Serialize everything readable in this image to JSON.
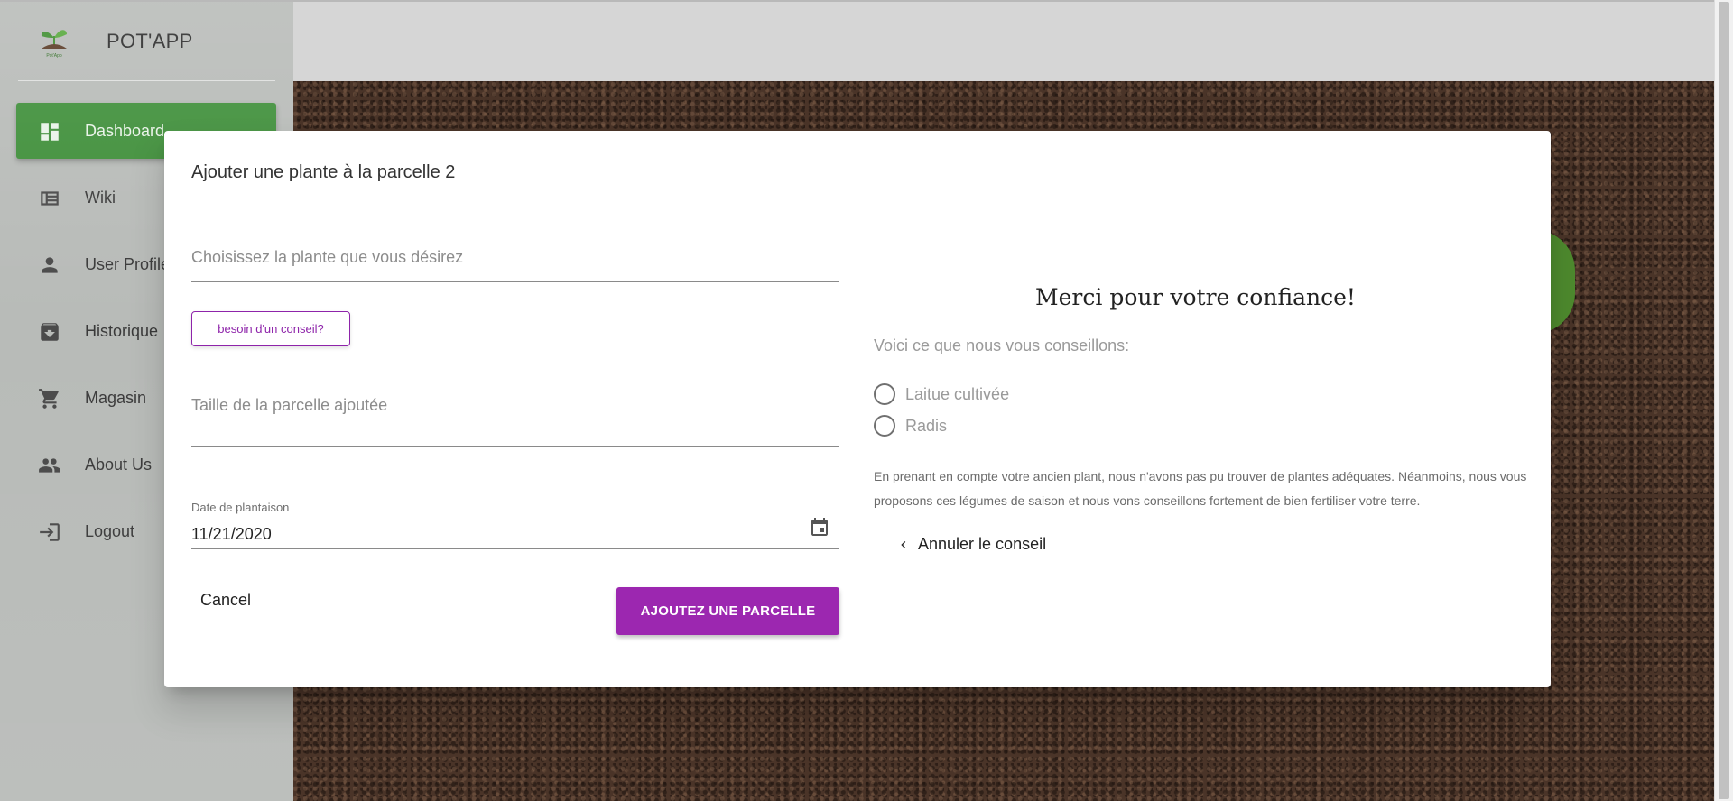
{
  "app": {
    "title": "POT'APP",
    "logo_text": "Pot'App"
  },
  "sidebar": {
    "items": [
      {
        "label": "Dashboard",
        "icon": "dashboard-icon",
        "active": true
      },
      {
        "label": "Wiki",
        "icon": "wiki-icon",
        "active": false
      },
      {
        "label": "User Profile",
        "icon": "person-icon",
        "active": false
      },
      {
        "label": "Historique",
        "icon": "archive-icon",
        "active": false
      },
      {
        "label": "Magasin",
        "icon": "cart-icon",
        "active": false
      },
      {
        "label": "About Us",
        "icon": "group-icon",
        "active": false
      },
      {
        "label": "Logout",
        "icon": "logout-icon",
        "active": false
      }
    ]
  },
  "dialog": {
    "title": "Ajouter une plante à la parcelle 2",
    "plant_field": {
      "placeholder": "Choisissez la plante que vous désirez",
      "value": ""
    },
    "advice_button": "besoin d'un conseil?",
    "size_field": {
      "placeholder": "Taille de la parcelle ajoutée",
      "value": ""
    },
    "date_field": {
      "label": "Date de plantaison",
      "value": "11/21/2020"
    },
    "cancel_label": "Cancel",
    "submit_label": "AJOUTEZ UNE PARCELLE",
    "advice": {
      "heading": "Merci pour votre confiance!",
      "intro": "Voici ce que nous vous conseillons:",
      "options": [
        "Laitue cultivée",
        "Radis"
      ],
      "note": "En prenant en compte votre ancien plant, nous n'avons pas pu trouver de plantes adéquates. Néanmoins, nous vous proposons ces légumes de saison et nous vons conseillons fortement de bien fertiliser votre terre.",
      "cancel_advice_label": "Annuler le conseil"
    }
  },
  "colors": {
    "accent": "#9c27b0",
    "sidebar_active": "#3f8f3a",
    "soil": "#4a3428"
  }
}
